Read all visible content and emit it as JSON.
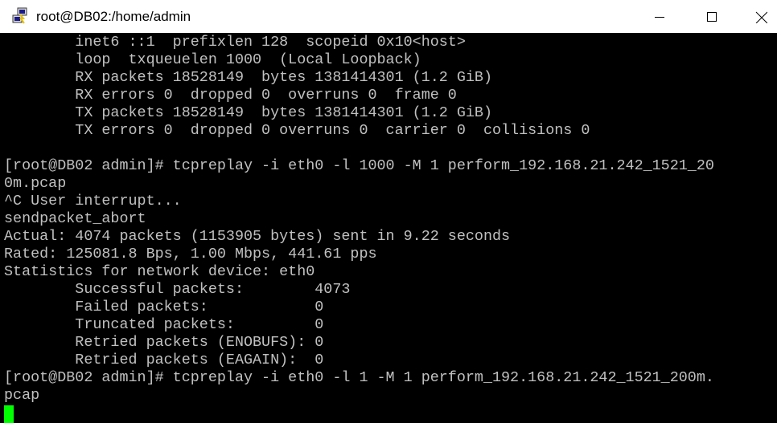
{
  "window": {
    "title": "root@DB02:/home/admin",
    "icon": "putty-terminal-icon",
    "controls": {
      "minimize": "minimize-icon",
      "maximize": "maximize-icon",
      "close": "close-icon"
    }
  },
  "terminal": {
    "lines": [
      "        inet6 ::1  prefixlen 128  scopeid 0x10<host>",
      "        loop  txqueuelen 1000  (Local Loopback)",
      "        RX packets 18528149  bytes 1381414301 (1.2 GiB)",
      "        RX errors 0  dropped 0  overruns 0  frame 0",
      "        TX packets 18528149  bytes 1381414301 (1.2 GiB)",
      "        TX errors 0  dropped 0 overruns 0  carrier 0  collisions 0",
      "",
      "[root@DB02 admin]# tcpreplay -i eth0 -l 1000 -M 1 perform_192.168.21.242_1521_20",
      "0m.pcap",
      "^C User interrupt...",
      "sendpacket_abort",
      "Actual: 4074 packets (1153905 bytes) sent in 9.22 seconds",
      "Rated: 125081.8 Bps, 1.00 Mbps, 441.61 pps",
      "Statistics for network device: eth0",
      "        Successful packets:        4073",
      "        Failed packets:            0",
      "        Truncated packets:         0",
      "        Retried packets (ENOBUFS): 0",
      "        Retried packets (EAGAIN):  0",
      "[root@DB02 admin]# tcpreplay -i eth0 -l 1 -M 1 perform_192.168.21.242_1521_200m.",
      "pcap"
    ]
  },
  "colors": {
    "terminal_bg": "#000000",
    "terminal_fg": "#c0c0c0",
    "cursor": "#00ff00",
    "titlebar_bg": "#ffffff"
  }
}
